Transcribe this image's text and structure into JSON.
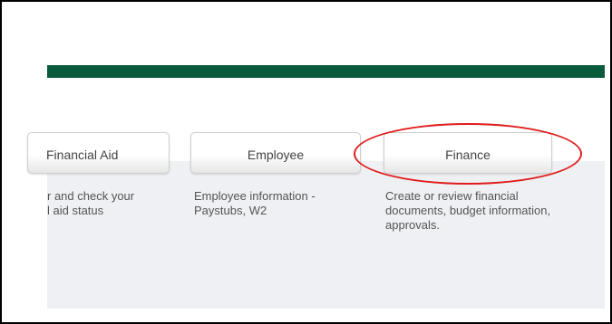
{
  "tabs": [
    {
      "label": "Financial Aid",
      "description": "r and check your\nl aid status"
    },
    {
      "label": "Employee",
      "description": "Employee information - Paystubs, W2"
    },
    {
      "label": "Finance",
      "description": "Create or review financial documents, budget information, approvals."
    }
  ],
  "colors": {
    "header_bar": "#0a5a3c",
    "panel_bg": "#eef0f3",
    "annotation": "#e01b1b"
  }
}
